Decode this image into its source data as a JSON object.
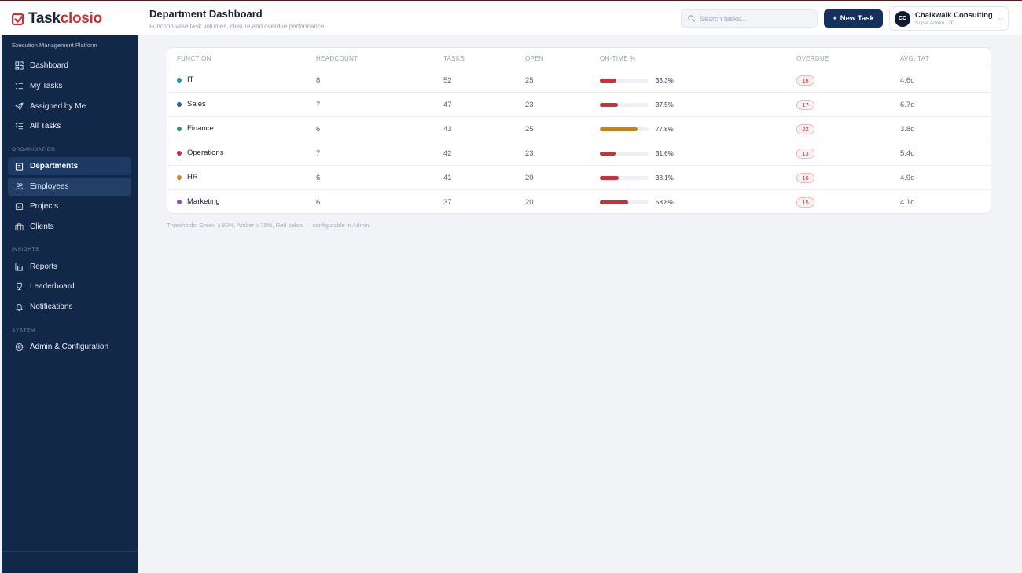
{
  "brand": {
    "part1": "Task",
    "part2": "closio"
  },
  "header": {
    "title": "Department Dashboard",
    "subtitle": "Function-wise task volumes, closure and overdue performance"
  },
  "search": {
    "placeholder": "Search tasks..."
  },
  "new_task_label": "New Task",
  "user": {
    "initials": "CC",
    "name": "Chalkwalk Consulting",
    "role": "Super Admin · IT"
  },
  "sidebar": {
    "platform_label": "Execution Management Platform",
    "sections": {
      "organisation": "ORGANISATION",
      "insights": "INSIGHTS",
      "system": "SYSTEM"
    },
    "items": [
      {
        "label": "Dashboard",
        "icon": "dashboard-icon"
      },
      {
        "label": "My Tasks",
        "icon": "checklist-icon"
      },
      {
        "label": "Assigned by Me",
        "icon": "send-icon"
      },
      {
        "label": "All Tasks",
        "icon": "list-icon"
      },
      {
        "label": "Departments",
        "icon": "building-icon"
      },
      {
        "label": "Employees",
        "icon": "users-icon"
      },
      {
        "label": "Projects",
        "icon": "folder-icon"
      },
      {
        "label": "Clients",
        "icon": "briefcase-icon"
      },
      {
        "label": "Reports",
        "icon": "bar-chart-icon"
      },
      {
        "label": "Leaderboard",
        "icon": "trophy-icon"
      },
      {
        "label": "Notifications",
        "icon": "bell-icon"
      },
      {
        "label": "Admin & Configuration",
        "icon": "gear-icon"
      }
    ]
  },
  "table": {
    "columns": [
      "FUNCTION",
      "HEADCOUNT",
      "TASKS",
      "OPEN",
      "ON-TIME %",
      "OVERDUE",
      "AVG. TAT"
    ],
    "rows": [
      {
        "function": "IT",
        "dot_color": "#2e8ab8",
        "headcount": "8",
        "tasks": "52",
        "open": "25",
        "on_time": "33.3%",
        "on_time_value": 33.3,
        "bar_color": "#c8323b",
        "overdue": "18",
        "avg_tat": "4.6d"
      },
      {
        "function": "Sales",
        "dot_color": "#2f5f8f",
        "headcount": "7",
        "tasks": "47",
        "open": "23",
        "on_time": "37.5%",
        "on_time_value": 37.5,
        "bar_color": "#c8323b",
        "overdue": "17",
        "avg_tat": "6.7d"
      },
      {
        "function": "Finance",
        "dot_color": "#2e9a5a",
        "headcount": "6",
        "tasks": "43",
        "open": "25",
        "on_time": "77.8%",
        "on_time_value": 77.8,
        "bar_color": "#c7831f",
        "overdue": "22",
        "avg_tat": "3.8d"
      },
      {
        "function": "Operations",
        "dot_color": "#c8323b",
        "headcount": "7",
        "tasks": "42",
        "open": "23",
        "on_time": "31.6%",
        "on_time_value": 31.6,
        "bar_color": "#c8323b",
        "overdue": "13",
        "avg_tat": "5.4d"
      },
      {
        "function": "HR",
        "dot_color": "#d08a1e",
        "headcount": "6",
        "tasks": "41",
        "open": "20",
        "on_time": "38.1%",
        "on_time_value": 38.1,
        "bar_color": "#c8323b",
        "overdue": "16",
        "avg_tat": "4.9d"
      },
      {
        "function": "Marketing",
        "dot_color": "#8a4fc0",
        "headcount": "6",
        "tasks": "37",
        "open": "20",
        "on_time": "58.8%",
        "on_time_value": 58.8,
        "bar_color": "#c8323b",
        "overdue": "15",
        "avg_tat": "4.1d"
      }
    ]
  },
  "footnote": "Thresholds: Green ≥ 90%, Amber ≥ 75%, Red below — configurable in Admin."
}
